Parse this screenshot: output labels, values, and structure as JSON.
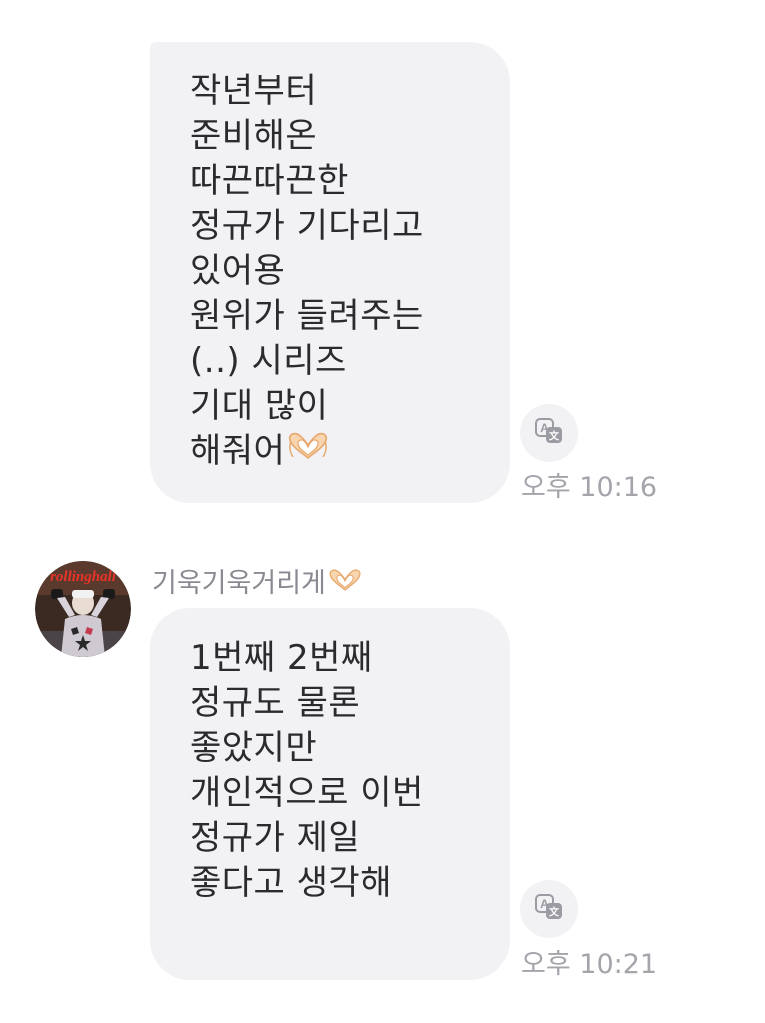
{
  "messages": [
    {
      "lines": [
        "작년부터",
        "준비해온",
        "따끈따끈한",
        "정규가 기다리고",
        "있어용",
        "원위가 들려주는",
        "(..) 시리즈",
        "기대 많이",
        "해줘어"
      ],
      "emoji": "heart-hands",
      "time": "오후 10:16"
    },
    {
      "sender": "기욱기욱거리게",
      "sender_emoji": "heart-hands",
      "lines": [
        "1번째 2번째",
        "정규도 물론",
        "좋았지만",
        "개인적으로 이번",
        "정규가 제일",
        "좋다고 생각해"
      ],
      "time": "오후 10:21"
    }
  ],
  "avatar_text": "rollinghall",
  "icons": {
    "translate": "translate-icon",
    "heart": "heart-hands-icon"
  },
  "colors": {
    "bubble": "#f2f2f5",
    "text": "#2a2a2f",
    "meta": "#a4a4ab"
  }
}
